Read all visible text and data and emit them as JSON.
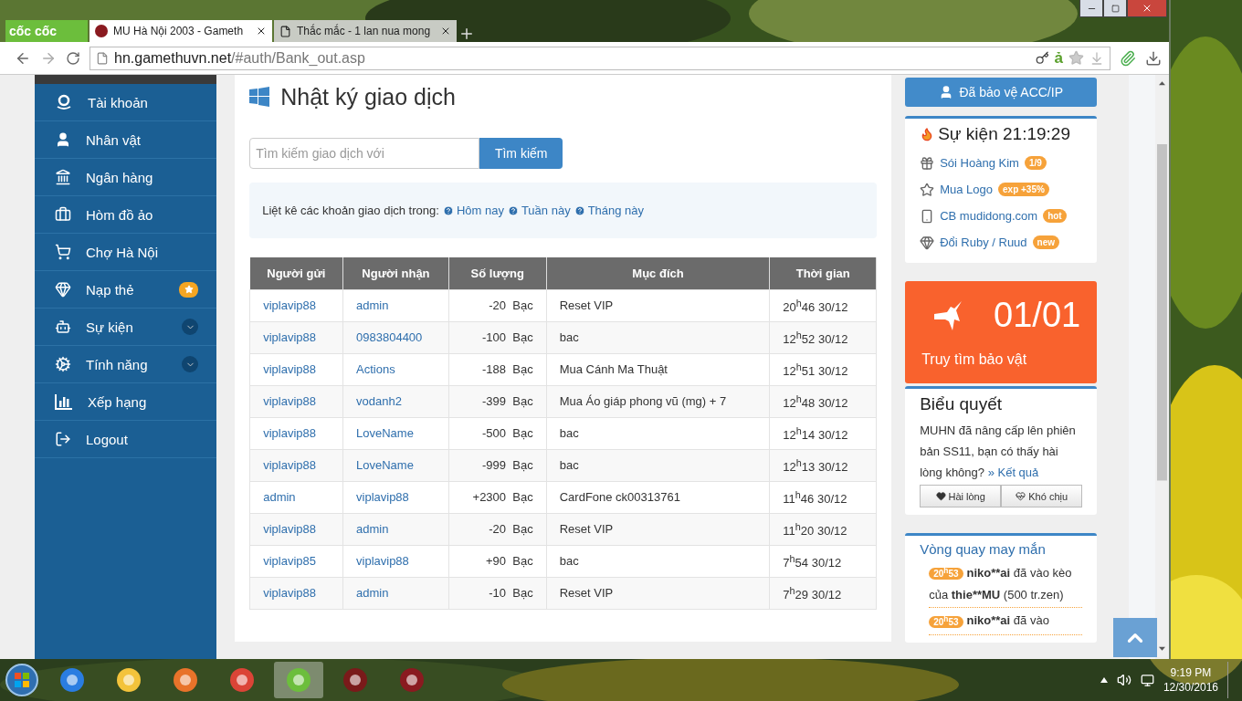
{
  "browser": {
    "logo": "cốc cốc",
    "tabs": [
      {
        "title": "MU Hà Nội 2003 - Gameth",
        "selected": true
      },
      {
        "title": "Thắc mắc - 1 lan nua mong",
        "selected": false
      }
    ],
    "address": {
      "host": "hn.gamethuvn.net",
      "path": "/#auth/Bank_out.asp"
    },
    "input_method": "ả"
  },
  "sidebar": {
    "items": [
      {
        "label": "Tài khoản",
        "kind": "plain"
      },
      {
        "label": "Nhân vật",
        "kind": "plain"
      },
      {
        "label": "Ngân hàng",
        "kind": "plain"
      },
      {
        "label": "Hòm đồ ảo",
        "kind": "plain"
      },
      {
        "label": "Chợ Hà Nội",
        "kind": "plain"
      },
      {
        "label": "Nạp thẻ",
        "kind": "star"
      },
      {
        "label": "Sự kiện",
        "kind": "expand"
      },
      {
        "label": "Tính năng",
        "kind": "expand"
      },
      {
        "label": "Xếp hạng",
        "kind": "plain"
      },
      {
        "label": "Logout",
        "kind": "plain"
      }
    ]
  },
  "page": {
    "title": "Nhật ký giao dịch",
    "search": {
      "placeholder": "Tìm kiếm giao dịch với",
      "button": "Tìm kiếm"
    },
    "filter": {
      "label": "Liệt kê các khoản giao dịch trong:",
      "links": [
        "Hôm nay",
        "Tuần này",
        "Tháng này"
      ]
    },
    "table": {
      "columns": [
        "Người gửi",
        "Người nhận",
        "Số lượng",
        "Mục đích",
        "Thời gian"
      ],
      "rows": [
        {
          "sender": "viplavip88",
          "recipient": "admin",
          "amount": "-20",
          "currency": "Bạc",
          "purpose": "Reset VIP",
          "time": "20$^{h}$46 30/12"
        },
        {
          "sender": "viplavip88",
          "recipient": "0983804400",
          "amount": "-100",
          "currency": "Bạc",
          "purpose": "bac",
          "time": "12$^{h}$52 30/12"
        },
        {
          "sender": "viplavip88",
          "recipient": "Actions",
          "amount": "-188",
          "currency": "Bạc",
          "purpose": "Mua Cánh Ma Thuật",
          "time": "12$^{h}$51 30/12"
        },
        {
          "sender": "viplavip88",
          "recipient": "vodanh2",
          "amount": "-399",
          "currency": "Bạc",
          "purpose": "Mua Áo giáp phong vũ (mg) + 7",
          "time": "12$^{h}$48 30/12"
        },
        {
          "sender": "viplavip88",
          "recipient": "LoveName",
          "amount": "-500",
          "currency": "Bạc",
          "purpose": "bac",
          "time": "12$^{h}$14 30/12"
        },
        {
          "sender": "viplavip88",
          "recipient": "LoveName",
          "amount": "-999",
          "currency": "Bạc",
          "purpose": "bac",
          "time": "12$^{h}$13 30/12"
        },
        {
          "sender": "admin",
          "recipient": "viplavip88",
          "amount": "+2300",
          "currency": "Bạc",
          "purpose": "CardFone ck00313761",
          "time": "11$^{h}$46 30/12"
        },
        {
          "sender": "viplavip88",
          "recipient": "admin",
          "amount": "-20",
          "currency": "Bạc",
          "purpose": "Reset VIP",
          "time": "11$^{h}$20 30/12"
        },
        {
          "sender": "viplavip85",
          "recipient": "viplavip88",
          "amount": "+90",
          "currency": "Bạc",
          "purpose": "bac",
          "time": "7$^{h}$54 30/12"
        },
        {
          "sender": "viplavip88",
          "recipient": "admin",
          "amount": "-10",
          "currency": "Bạc",
          "purpose": "Reset VIP",
          "time": "7$^{h}$29 30/12"
        }
      ]
    }
  },
  "right": {
    "protect_button": "Đã bảo vệ ACC/IP",
    "events": {
      "title": "Sự kiện 21:19:29",
      "items": [
        {
          "label": "Sói Hoàng Kim",
          "badge": "1/9"
        },
        {
          "label": "Mua Logo",
          "badge": "exp +35%"
        },
        {
          "label": "CB mudidong.com",
          "badge": "hot"
        },
        {
          "label": "Đổi Ruby / Ruud",
          "badge": "new"
        }
      ]
    },
    "treasure": {
      "count": "01/01",
      "label": "Truy tìm bảo vật"
    },
    "poll": {
      "title": "Biểu quyết",
      "text": "MUHN đã nâng cấp lên phiên bản SS11, bạn có thấy hài lòng không?",
      "link": "» Kết quả",
      "buttons": [
        "Hài lòng",
        "Khó chịu"
      ]
    },
    "wheel": {
      "title": "Vòng quay may mắn",
      "entries": [
        {
          "time": "20$^{h}$53",
          "user": "niko**ai",
          "text": " đã vào kèo của ",
          "target": "thie**MU",
          "tail": " (500 tr.zen)"
        },
        {
          "time": "20$^{h}$53",
          "user": "niko**ai",
          "text": " đã vào"
        }
      ]
    }
  },
  "taskbar": {
    "time": "9:19 PM",
    "date": "12/30/2016"
  }
}
